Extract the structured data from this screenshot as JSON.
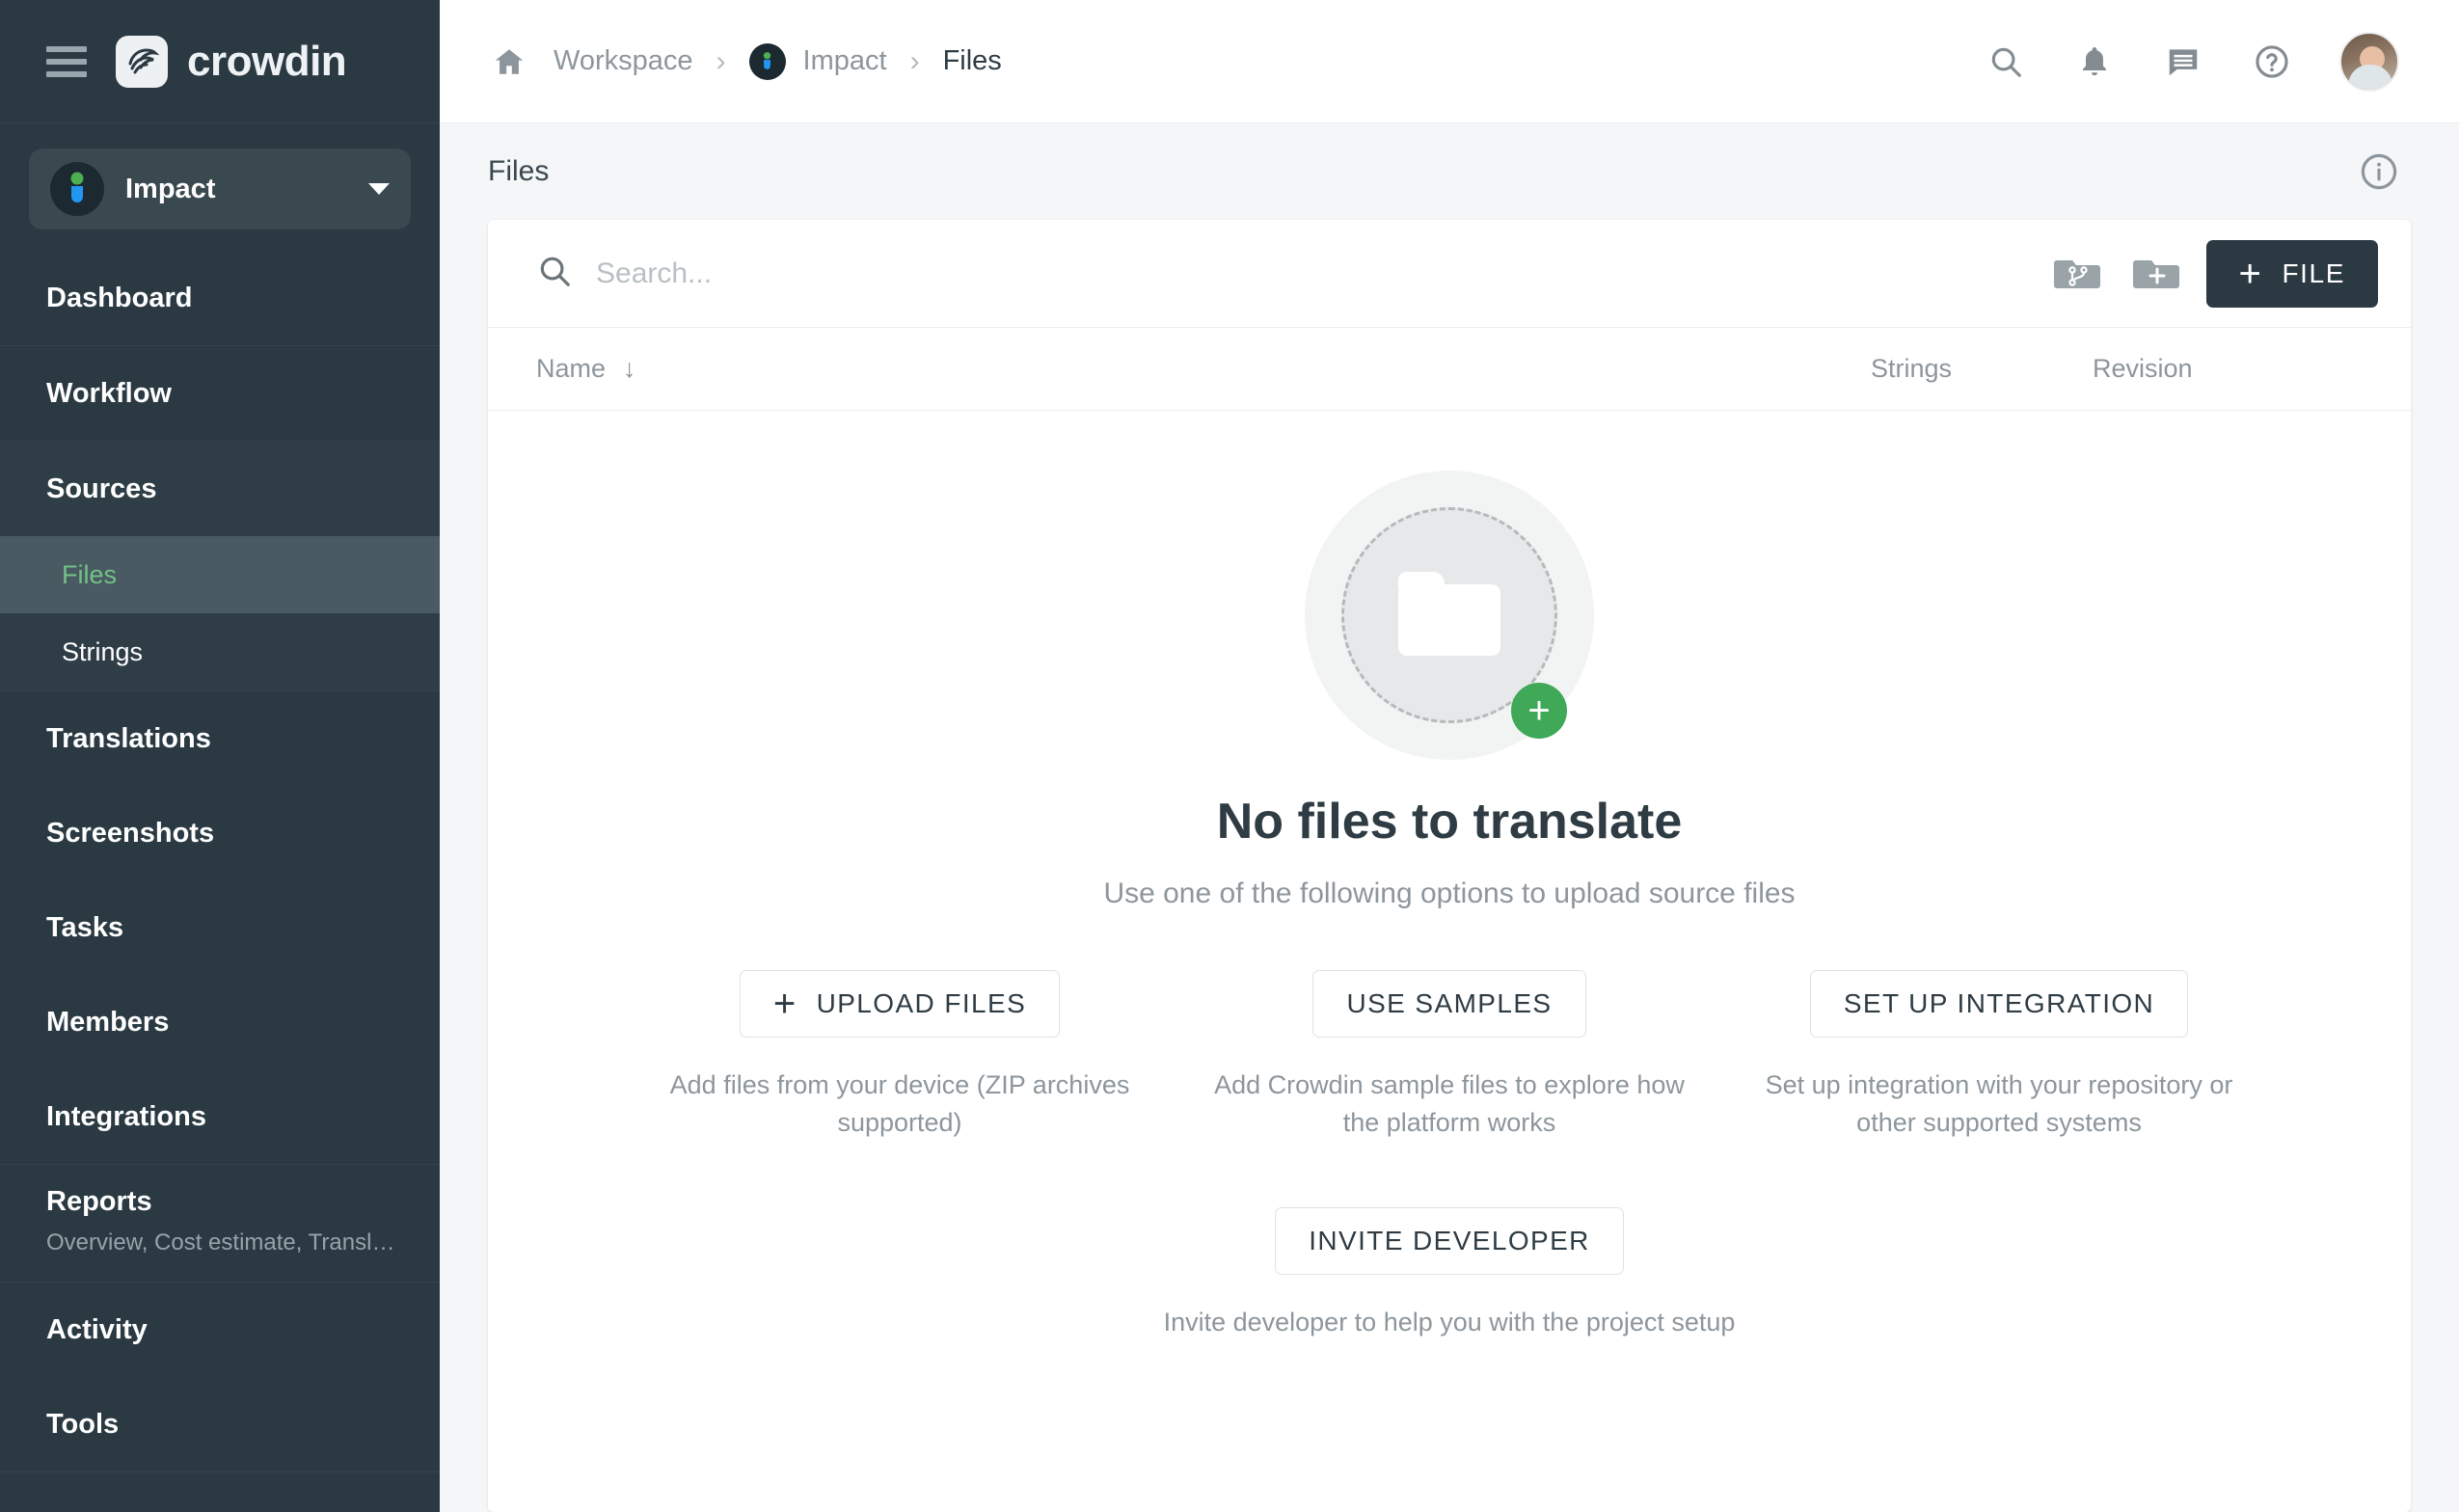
{
  "brand": {
    "name": "crowdin"
  },
  "project_switcher": {
    "name": "Impact"
  },
  "sidebar": {
    "items": [
      {
        "label": "Dashboard"
      },
      {
        "label": "Workflow"
      },
      {
        "label": "Sources"
      },
      {
        "label": "Files"
      },
      {
        "label": "Strings"
      },
      {
        "label": "Translations"
      },
      {
        "label": "Screenshots"
      },
      {
        "label": "Tasks"
      },
      {
        "label": "Members"
      },
      {
        "label": "Integrations"
      },
      {
        "label": "Reports",
        "sub": "Overview, Cost estimate, Transl…"
      },
      {
        "label": "Activity"
      },
      {
        "label": "Tools"
      }
    ]
  },
  "breadcrumb": {
    "home_icon": "home-icon",
    "workspace": "Workspace",
    "project": "Impact",
    "current": "Files",
    "separator": "›"
  },
  "topbar_icons": [
    {
      "name": "search-icon"
    },
    {
      "name": "notifications-bell-icon"
    },
    {
      "name": "messages-icon"
    },
    {
      "name": "help-question-icon"
    },
    {
      "name": "user-avatar"
    }
  ],
  "page": {
    "title": "Files",
    "info_icon": "info-icon"
  },
  "toolbar": {
    "search_placeholder": "Search...",
    "search_value": "",
    "branch_button": "new-branch-icon",
    "folder_button": "new-folder-icon",
    "file_button": "FILE",
    "file_button_plus": "+"
  },
  "table": {
    "columns": [
      {
        "label": "Name",
        "sort": "↓"
      },
      {
        "label": "Strings"
      },
      {
        "label": "Revision"
      }
    ]
  },
  "empty_state": {
    "title": "No files to translate",
    "subtitle": "Use one of the following options to upload source files",
    "illustration": "empty-folder-illustration",
    "options": [
      {
        "label": "UPLOAD FILES",
        "has_plus": true,
        "plus": "+",
        "description": "Add files from your device (ZIP archives supported)"
      },
      {
        "label": "USE SAMPLES",
        "has_plus": false,
        "description": "Add Crowdin sample files to explore how the platform works"
      },
      {
        "label": "SET UP INTEGRATION",
        "has_plus": false,
        "description": "Set up integration with your repository or other supported systems"
      }
    ],
    "invite": {
      "label": "INVITE DEVELOPER",
      "description": "Invite developer to help you with the project setup"
    }
  },
  "colors": {
    "sidebar_bg": "#2a3942",
    "accent_green": "#71c285",
    "badge_green": "#3fa958",
    "primary_dark": "#2a3942",
    "muted_text": "#8d969c"
  }
}
